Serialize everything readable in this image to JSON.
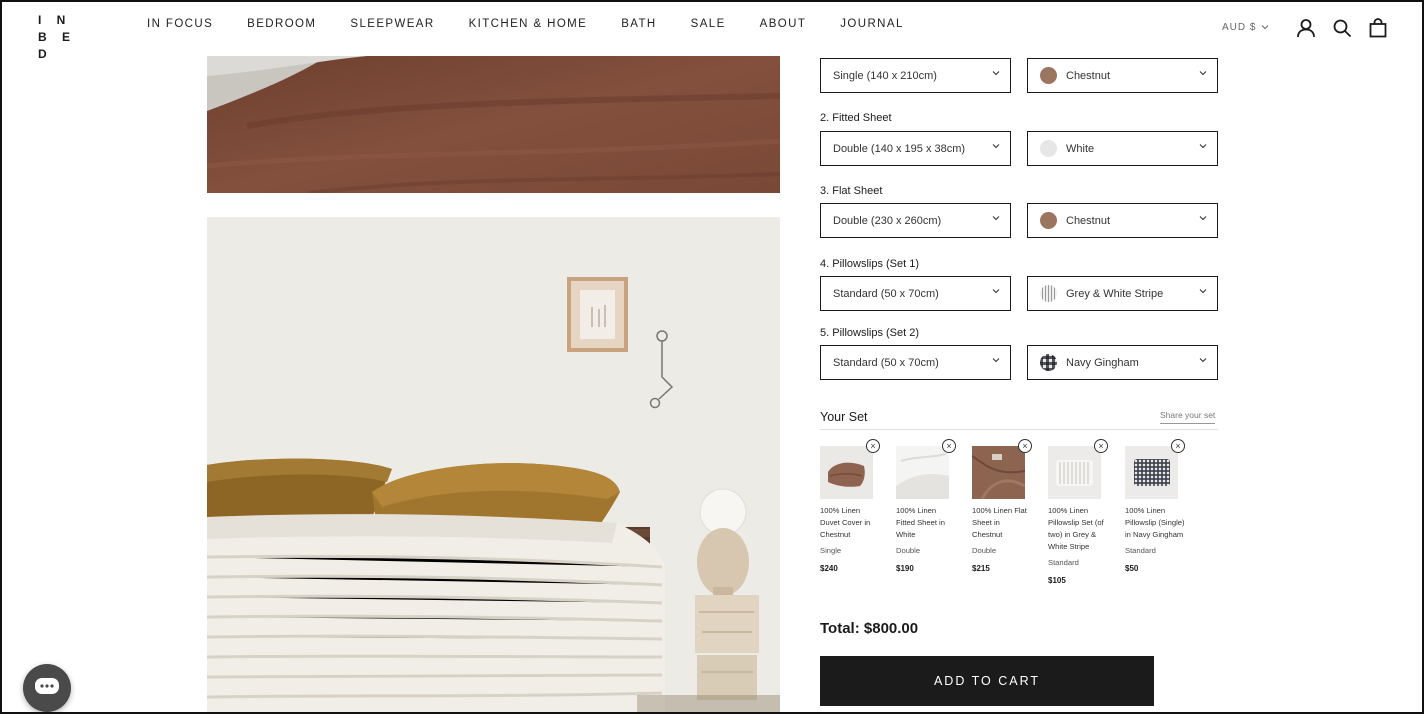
{
  "brand": {
    "logo_line1": "I N",
    "logo_line2": "B E D"
  },
  "nav": [
    "IN FOCUS",
    "BEDROOM",
    "SLEEPWEAR",
    "KITCHEN & HOME",
    "BATH",
    "SALE",
    "ABOUT",
    "JOURNAL"
  ],
  "header": {
    "currency": "AUD $"
  },
  "icons": {
    "account": "account-icon",
    "search": "search-icon",
    "cart": "cart-bag-icon",
    "chat": "chat-icon"
  },
  "configurator": {
    "row1": {
      "size": "Single (140 x 210cm)",
      "color": "Chestnut"
    },
    "row2": {
      "label": "2. Fitted Sheet",
      "size": "Double (140 x 195 x 38cm)",
      "color": "White"
    },
    "row3": {
      "label": "3. Flat Sheet",
      "size": "Double (230 x 260cm)",
      "color": "Chestnut"
    },
    "row4": {
      "label": "4. Pillowslips (Set 1)",
      "size": "Standard (50 x 70cm)",
      "color": "Grey & White Stripe"
    },
    "row5": {
      "label": "5. Pillowslips (Set 2)",
      "size": "Standard (50 x 70cm)",
      "color": "Navy Gingham"
    }
  },
  "set": {
    "title": "Your Set",
    "share": "Share your set",
    "items": [
      {
        "name": "100% Linen Duvet Cover in Chestnut",
        "size": "Single",
        "price": "$240"
      },
      {
        "name": "100% Linen Fitted Sheet in White",
        "size": "Double",
        "price": "$190"
      },
      {
        "name": "100% Linen Flat Sheet in Chestnut",
        "size": "Double",
        "price": "$215"
      },
      {
        "name": "100% Linen Pillowslip Set (of two) in Grey & White Stripe",
        "size": "Standard",
        "price": "$105"
      },
      {
        "name": "100% Linen Pillowslip (Single) in Navy Gingham",
        "size": "Standard",
        "price": "$50"
      }
    ],
    "remove_symbol": "×"
  },
  "total": "Total: $800.00",
  "add_to_cart": "ADD TO CART",
  "colors": {
    "chestnut": "#9c7560",
    "dark": "#1c1b1b",
    "white_swatch": "#e6e6e6"
  }
}
